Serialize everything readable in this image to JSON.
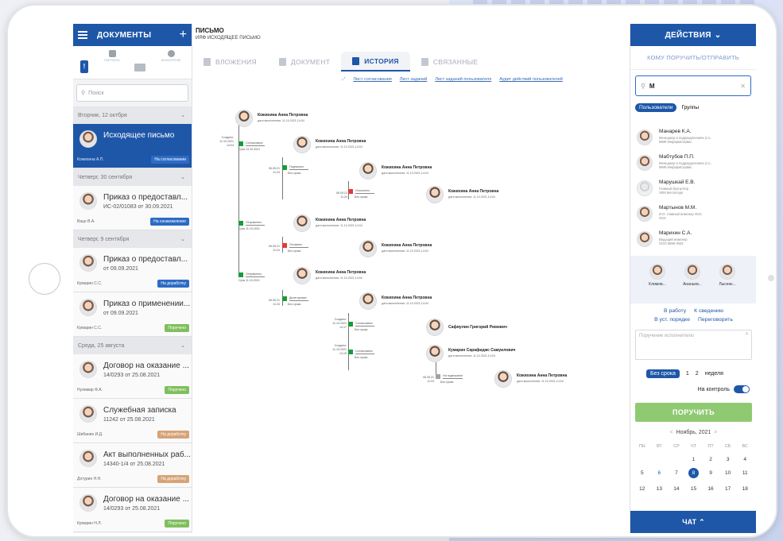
{
  "left": {
    "title": "ДОКУМЕНТЫ",
    "plus": "+",
    "tools": [
      "ПОРУЧЕНО",
      "НА КОНТРОЛЕ"
    ],
    "search_placeholder": "Поиск",
    "groups": [
      {
        "day": "Вторник, 12 октбря"
      },
      {
        "day": "Четверг, 30 сентября"
      },
      {
        "day": "Четверг, 9 сентября"
      },
      {
        "day": "Среда, 25 августа"
      }
    ],
    "items": [
      {
        "title": "Исходящее письмо",
        "sub": "",
        "who": "Кожихина А.П.",
        "badge": "На согласовании",
        "color": "#2d6bc4"
      },
      {
        "title": "Приказ о предоставл...",
        "sub": "ИС-02/01083 от 30.09.2021",
        "who": "Вацо В.А.",
        "badge": "На ознакомление",
        "color": "#2d6bc4"
      },
      {
        "title": "Приказ о предоставл...",
        "sub": "от 09.09.2021",
        "who": "Кумарин С.С.",
        "badge": "На доработку",
        "color": "#2d6bc4"
      },
      {
        "title": "Приказ о применении...",
        "sub": "от 09.09.2021",
        "who": "Кумарин С.С.",
        "badge": "Поручено",
        "color": "#7fbf5d"
      },
      {
        "title": "Договор на оказание ...",
        "sub": "14/0293 от 25.08.2021",
        "who": "Нулимар Ф.А.",
        "badge": "Поручено",
        "color": "#7fbf5d"
      },
      {
        "title": "Служебная записка",
        "sub": "11242 от 25.08.2021",
        "who": "Шибанин И.Д.",
        "badge": "На доработку",
        "color": "#d7a377"
      },
      {
        "title": "Акт выполненных раб...",
        "sub": "14340-1/4 от 25.08.2021",
        "who": "Дотурин Н.Н.",
        "badge": "На доработку",
        "color": "#d7a377"
      },
      {
        "title": "Договор на оказание ...",
        "sub": "14/0293 от 25.08.2021",
        "who": "Кумарин Н.Л.",
        "badge": "Поручено",
        "color": "#7fbf5d"
      }
    ]
  },
  "center": {
    "title": "ПИСЬМО",
    "subtitle": "ИЯФ ИСХОДЯЩЕЕ ПИСЬМО",
    "tabs": [
      "ВЛОЖЕНИЯ",
      "ДОКУМЕНТ",
      "ИСТОРИЯ",
      "СВЯЗАННЫЕ"
    ],
    "links": [
      "Лист согласования",
      "Лист заданий",
      "Лист заданий пользователя",
      "Аудит действий пользователей"
    ],
    "tree": {
      "n1": {
        "name": "Кожихина Анна Петровна",
        "date": "дата выполнения: 11.10.2021,14:04"
      },
      "n2": {
        "name": "Кожихина Анна Петровна",
        "date": "дата выполнения: 11.10.2021,14:04"
      },
      "n3": {
        "name": "Кожихина Анна Петровна",
        "date": "дата выполнения: 11.10.2021,14:04"
      },
      "n4": {
        "name": "Кожихина Анна Петровна",
        "date": "дата выполнения: 11.10.2021,14:04"
      },
      "n5": {
        "name": "Кожихина Анна Петровна",
        "date": "дата выполнения: 11.10.2021,14:04"
      },
      "n6": {
        "name": "Кожихина Анна Петровна",
        "date": "дата выполнения: 11.10.2021,14:04"
      },
      "n7": {
        "name": "Кожихина Анна Петровна",
        "date": "дата выполнения: 11.10.2021,14:04"
      },
      "n8": {
        "name": "Кожихина Анна Петровна",
        "date": "дата выполнения: 11.10.2021,14:04"
      },
      "n9": {
        "name": "Сафиулин Григорий Римович",
        "date": ""
      },
      "n10": {
        "name": "Кумарин Сарафиджс Самуилович",
        "date": "дата выполнения: 11.10.2021,14:04"
      },
      "n11": {
        "name": "Кожихина Анна Петровна",
        "date": "дата выполнения: 11.10.2021,14:04"
      },
      "created_label": "Создано",
      "created_date": "11.10.2021",
      "created_time": "14:04",
      "s1": "Согласовано",
      "s1t": "Срок 13.10.2021",
      "s2": "Подписано",
      "s2t": "Без срока",
      "s2d": "06.05.21",
      "s2h": "11:24",
      "s3": "Отклонено",
      "s3t": "Без срока",
      "s3d": "06.05.21",
      "s3h": "11:24",
      "s4": "Отправлено",
      "s4t": "Срок 11.10.2021",
      "s5": "Отозвано",
      "s5t": "Без срока",
      "s5d": "06.05.21",
      "s5h": "11:24",
      "s6": "Отправлено",
      "s6t": "Срок 11.10.2021",
      "s7": "Делегирован",
      "s7t": "Без срока",
      "s7d": "06.05.21",
      "s7h": "11:24",
      "s8": "Согласовано",
      "s8t": "Без срока",
      "s8c": "Создано:",
      "s8d": "11.10.2021",
      "s8h": "14:17",
      "s9": "Согласовано",
      "s9t": "Без срока",
      "s9c": "Создано:",
      "s9d": "11.10.2021",
      "s9h": "14:19",
      "s10": "На подписание",
      "s10t": "Без срока",
      "s10d": "06.05.21",
      "s10h": "11:24"
    }
  },
  "right": {
    "title": "ДЕЙСТВИЯ",
    "subtitle": "КОМУ ПОРУЧИТЬ/ОТПРАВИТЬ",
    "search_value": "М",
    "tab_users": "Пользователи",
    "tab_groups": "Группы",
    "users": [
      {
        "name": "Манарев К.А.",
        "d1": "Менеджер в подразделениях (сл...",
        "d2": "ММК-ИнформСервис"
      },
      {
        "name": "Мабтубов П.П.",
        "d1": "Менеджер в подразделениях (сл...",
        "d2": "ММК-ИнформСервис"
      },
      {
        "name": "Марушкай Е.В.",
        "d1": "Главный бухгалтер",
        "d2": "ХКМ Металлург"
      },
      {
        "name": "Мартынов М.М.",
        "d1": "И.О. главный инженер ОСК",
        "d2": "ОСК"
      },
      {
        "name": "Марихин С.А.",
        "d1": "Ведущий инженер",
        "d2": "ООО ММК-ЛМЗ"
      }
    ],
    "chosen": [
      "Климов...",
      "Ананьев...",
      "Лысенк..."
    ],
    "actions": [
      "В работу",
      "К сведению",
      "В уст. порядке",
      "Переговорить"
    ],
    "note_placeholder": "Поручение исполнителю",
    "term": [
      "Без срока",
      "1",
      "2",
      "неделя"
    ],
    "control_label": "На контроль",
    "assign_label": "ПОРУЧИТЬ",
    "calendar": {
      "month": "Ноябрь, 2021",
      "weekdays": [
        "ПН",
        "ВТ",
        "СР",
        "ЧТ",
        "ПТ",
        "СБ",
        "ВС"
      ],
      "days": [
        "",
        "",
        "",
        "1",
        "2",
        "3",
        "4",
        "5",
        "6",
        "7",
        "8",
        "9",
        "10",
        "11",
        "12",
        "13",
        "14",
        "15",
        "16",
        "17",
        "18"
      ],
      "selected": "8"
    },
    "chat_label": "ЧАТ"
  },
  "colors": {
    "brand": "#1e57a8",
    "green": "#8fca73",
    "ok": "#1a9b3a",
    "reject": "#e23a3a",
    "gray": "#9ea3aa"
  }
}
